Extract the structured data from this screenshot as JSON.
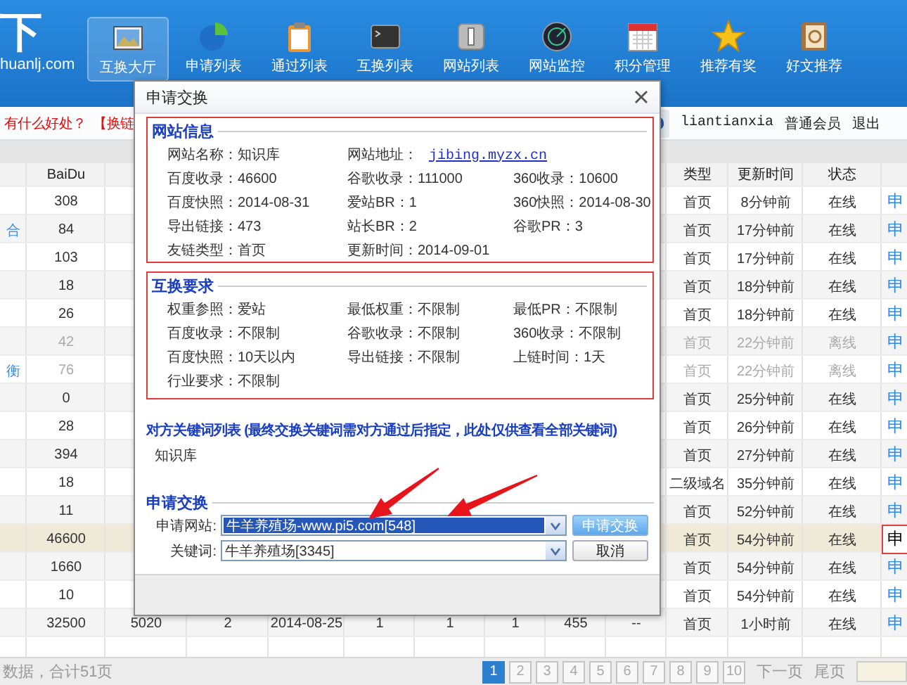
{
  "header": {
    "logo": {
      "mark": "下",
      "domain": "huanlj.com"
    },
    "nav": [
      {
        "label": "互换大厅",
        "selected": true
      },
      {
        "label": "申请列表",
        "selected": false
      },
      {
        "label": "通过列表",
        "selected": false
      },
      {
        "label": "互换列表",
        "selected": false
      },
      {
        "label": "网站列表",
        "selected": false
      },
      {
        "label": "网站监控",
        "selected": false
      },
      {
        "label": "积分管理",
        "selected": false
      },
      {
        "label": "推荐有奖",
        "selected": false
      },
      {
        "label": "好文推荐",
        "selected": false
      }
    ]
  },
  "subbar": {
    "links": [
      "有什么好处？",
      "【换链"
    ],
    "user": {
      "name": "liantianxia",
      "role": "普通会员",
      "logout": "退出"
    }
  },
  "table": {
    "headers": {
      "baidu": "BaiDu",
      "type": "类型",
      "updated": "更新时间",
      "status": "状态"
    },
    "rows": [
      {
        "baidu": "308",
        "type": "首页",
        "updated": "8分钟前",
        "status": "在线",
        "action": "申",
        "online": true,
        "selected": false
      },
      {
        "site": "合",
        "baidu": "84",
        "type": "首页",
        "updated": "17分钟前",
        "status": "在线",
        "action": "申",
        "online": true,
        "selected": false
      },
      {
        "baidu": "103",
        "type": "首页",
        "updated": "17分钟前",
        "status": "在线",
        "action": "申",
        "online": true,
        "selected": false
      },
      {
        "baidu": "18",
        "type": "首页",
        "updated": "18分钟前",
        "status": "在线",
        "action": "申",
        "online": true,
        "selected": false
      },
      {
        "baidu": "26",
        "type": "首页",
        "updated": "18分钟前",
        "status": "在线",
        "action": "申",
        "online": true,
        "selected": false
      },
      {
        "baidu": "42",
        "type": "首页",
        "updated": "22分钟前",
        "status": "离线",
        "action": "申",
        "online": false,
        "selected": false
      },
      {
        "site": "衡",
        "baidu": "76",
        "type": "首页",
        "updated": "22分钟前",
        "status": "离线",
        "action": "申",
        "online": false,
        "selected": false
      },
      {
        "baidu": "0",
        "type": "首页",
        "updated": "25分钟前",
        "status": "在线",
        "action": "申",
        "online": true,
        "selected": false
      },
      {
        "baidu": "28",
        "type": "首页",
        "updated": "26分钟前",
        "status": "在线",
        "action": "申",
        "online": true,
        "selected": false
      },
      {
        "baidu": "394",
        "type": "首页",
        "updated": "27分钟前",
        "status": "在线",
        "action": "申",
        "online": true,
        "selected": false
      },
      {
        "baidu": "18",
        "type": "二级域名",
        "updated": "35分钟前",
        "status": "在线",
        "action": "申",
        "online": true,
        "selected": false
      },
      {
        "baidu": "11",
        "type": "首页",
        "updated": "52分钟前",
        "status": "在线",
        "action": "申",
        "online": true,
        "selected": false
      },
      {
        "baidu": "46600",
        "type": "首页",
        "updated": "54分钟前",
        "status": "在线",
        "action": "申",
        "online": true,
        "selected": true
      },
      {
        "baidu": "1660",
        "type": "首页",
        "updated": "54分钟前",
        "status": "在线",
        "action": "申",
        "online": true,
        "selected": false
      },
      {
        "baidu": "10",
        "type": "首页",
        "updated": "54分钟前",
        "status": "在线",
        "action": "申",
        "online": true,
        "selected": false
      },
      {
        "baidu": "32500",
        "middle": [
          "5020",
          "2",
          "2014-08-25",
          "1",
          "1",
          "1",
          "455",
          "--"
        ],
        "type": "首页",
        "updated": "1小时前",
        "status": "在线",
        "action": "申",
        "online": true,
        "selected": false
      }
    ]
  },
  "pager": {
    "summary": "数据，合计51页",
    "pages": [
      {
        "label": "1",
        "selected": true
      },
      {
        "label": "2",
        "selected": false
      },
      {
        "label": "3",
        "selected": false
      },
      {
        "label": "4",
        "selected": false
      },
      {
        "label": "5",
        "selected": false
      },
      {
        "label": "6",
        "selected": false
      },
      {
        "label": "7",
        "selected": false
      },
      {
        "label": "8",
        "selected": false
      },
      {
        "label": "9",
        "selected": false
      },
      {
        "label": "10",
        "selected": false
      }
    ],
    "next": "下一页",
    "last": "尾页"
  },
  "dialog": {
    "title": "申请交换",
    "site_info": {
      "title": "网站信息",
      "rows": [
        [
          {
            "kind": "text",
            "text": "网站名称：知识库"
          },
          {
            "kind": "link",
            "label": "网站地址：",
            "link": "jibing.myzx.cn"
          }
        ],
        [
          {
            "kind": "text",
            "text": "百度收录：46600"
          },
          {
            "kind": "text",
            "text": "谷歌收录：111000"
          },
          {
            "kind": "text",
            "text": "360收录：10600"
          }
        ],
        [
          {
            "kind": "text",
            "text": "百度快照：2014-08-31"
          },
          {
            "kind": "text",
            "text": "爱站BR：1"
          },
          {
            "kind": "text",
            "text": "360快照：2014-08-30"
          }
        ],
        [
          {
            "kind": "text",
            "text": "导出链接：473"
          },
          {
            "kind": "text",
            "text": "站长BR：2"
          },
          {
            "kind": "text",
            "text": "谷歌PR：3"
          }
        ],
        [
          {
            "kind": "text",
            "text": "友链类型：首页"
          },
          {
            "kind": "text",
            "text": "更新时间：2014-09-01"
          }
        ]
      ]
    },
    "requirements": {
      "title": "互换要求",
      "rows": [
        [
          {
            "kind": "text",
            "text": "权重参照：爱站"
          },
          {
            "kind": "text",
            "text": "最低权重：不限制"
          },
          {
            "kind": "text",
            "text": "最低PR：不限制"
          }
        ],
        [
          {
            "kind": "text",
            "text": "百度收录：不限制"
          },
          {
            "kind": "text",
            "text": "谷歌收录：不限制"
          },
          {
            "kind": "text",
            "text": "360收录：不限制"
          }
        ],
        [
          {
            "kind": "text",
            "text": "百度快照：10天以内"
          },
          {
            "kind": "text",
            "text": "导出链接：不限制"
          },
          {
            "kind": "text",
            "text": "上链时间：1天"
          }
        ],
        [
          {
            "kind": "text",
            "text": "行业要求：不限制"
          }
        ]
      ]
    },
    "keywords": {
      "title": "对方关键词列表 (最终交换关键词需对方通过后指定，此处仅供查看全部关键词)",
      "items": [
        "知识库"
      ]
    },
    "apply": {
      "title": "申请交换",
      "fields": [
        {
          "label": "申请网站:",
          "value": "牛羊养殖场-www.pi5.com[548]",
          "highlighted": true
        },
        {
          "label": "关键词:",
          "value": "牛羊养殖场[3345]",
          "highlighted": false
        }
      ],
      "buttons": [
        {
          "label": "申请交换",
          "kind": "primary"
        },
        {
          "label": "取消",
          "kind": "default"
        }
      ]
    }
  }
}
